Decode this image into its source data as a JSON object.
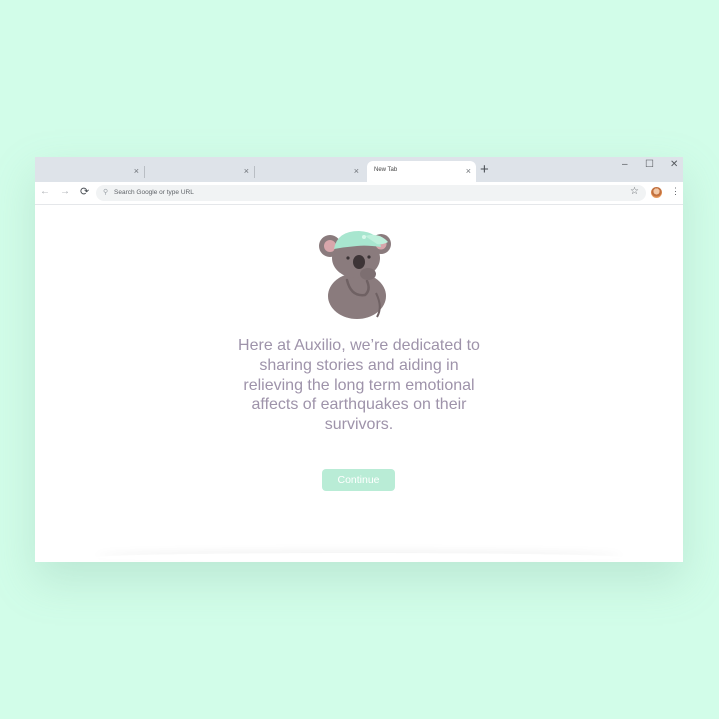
{
  "browser": {
    "tabs": [
      {
        "title": "",
        "close": "×",
        "active": false
      },
      {
        "title": "",
        "close": "×",
        "active": false
      },
      {
        "title": "",
        "close": "×",
        "active": false
      },
      {
        "title": "New Tab",
        "close": "×",
        "active": true
      }
    ],
    "new_tab": "+",
    "window_controls": {
      "minimize": "–",
      "maximize": "☐",
      "close": "✕"
    },
    "nav": {
      "back": "←",
      "forward": "→",
      "reload": "⟳"
    },
    "omnibox": {
      "placeholder": "Search Google or type URL",
      "search_icon": "search-icon"
    },
    "bookmark_icon": "☆",
    "menu_icon": "⋮"
  },
  "page": {
    "illustration": "koala-with-mint-cap",
    "message": "Here at Auxilio, we’re dedicated to sharing stories and aiding in relieving the long term emotional affects of earthquakes on their survivors.",
    "continue_label": "Continue"
  },
  "colors": {
    "background": "#d2fde9",
    "text": "#9e93aa",
    "button": "#b9ecd6",
    "cap": "#a8e6cf",
    "koala": "#8a7b7d"
  }
}
